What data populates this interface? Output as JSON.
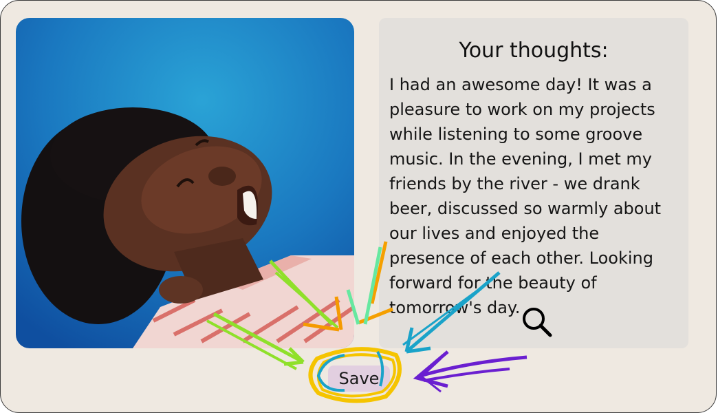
{
  "thoughts": {
    "title": "Your thoughts:",
    "text": "I had an awesome day! It was a pleasure to work on my projects while listening to some groove music. In the evening, I met my friends by the river - we drank beer, discussed so warmly about our lives and enjoyed the presence of each other. Looking forward for the beauty of tomorrow's day."
  },
  "actions": {
    "save_label": "Save"
  },
  "icons": {
    "search": "search-icon"
  },
  "colors": {
    "background": "#efe9e1",
    "panel": "#e3e0dc",
    "save_button": "#e2cfe0",
    "photo_background": "#1f7fc0",
    "annotation_yellow": "#f5c400",
    "annotation_blue": "#1aa3c9",
    "annotation_purple": "#6a1fd0",
    "annotation_green": "#8fe02a",
    "annotation_orange": "#f59a00",
    "annotation_mint": "#66e8a0"
  }
}
